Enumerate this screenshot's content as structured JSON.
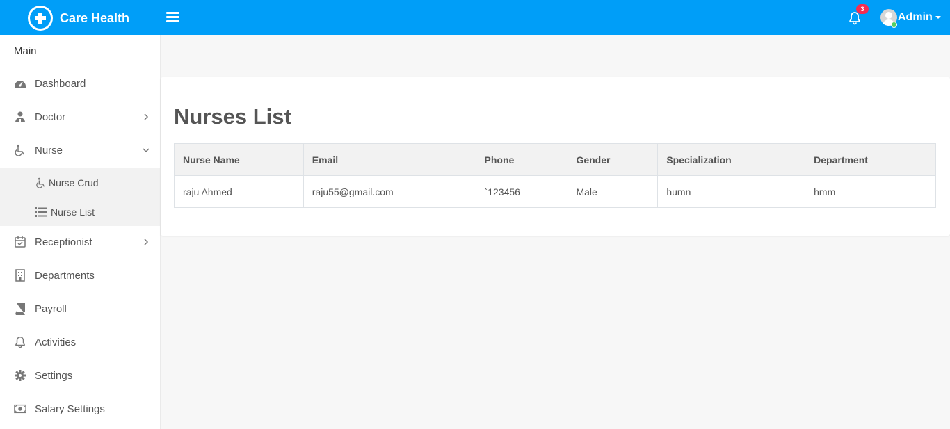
{
  "header": {
    "brand": "Care Health",
    "notification_count": "3",
    "user_name": "Admin"
  },
  "sidebar": {
    "section_title": "Main",
    "items": [
      {
        "label": "Dashboard",
        "icon": "dashboard-icon"
      },
      {
        "label": "Doctor",
        "icon": "doctor-icon"
      },
      {
        "label": "Nurse",
        "icon": "wheelchair-icon"
      },
      {
        "label": "Receptionist",
        "icon": "calendar-check-icon"
      },
      {
        "label": "Departments",
        "icon": "building-icon"
      },
      {
        "label": "Payroll",
        "icon": "book-icon"
      },
      {
        "label": "Activities",
        "icon": "bell-icon"
      },
      {
        "label": "Settings",
        "icon": "gear-icon"
      },
      {
        "label": "Salary Settings",
        "icon": "money-icon"
      }
    ],
    "nurse_submenu": [
      {
        "label": "Nurse Crud",
        "icon": "wheelchair-icon"
      },
      {
        "label": "Nurse List",
        "icon": "list-icon"
      }
    ]
  },
  "main": {
    "title": "Nurses List",
    "table": {
      "columns": [
        "Nurse Name",
        "Email",
        "Phone",
        "Gender",
        "Specialization",
        "Department"
      ],
      "rows": [
        [
          "raju Ahmed",
          "raju55@gmail.com",
          "`123456",
          "Male",
          "humn",
          "hmm"
        ]
      ]
    }
  },
  "colors": {
    "topbar": "#009ef8",
    "badge": "#f62d51",
    "online": "#55ce63"
  }
}
